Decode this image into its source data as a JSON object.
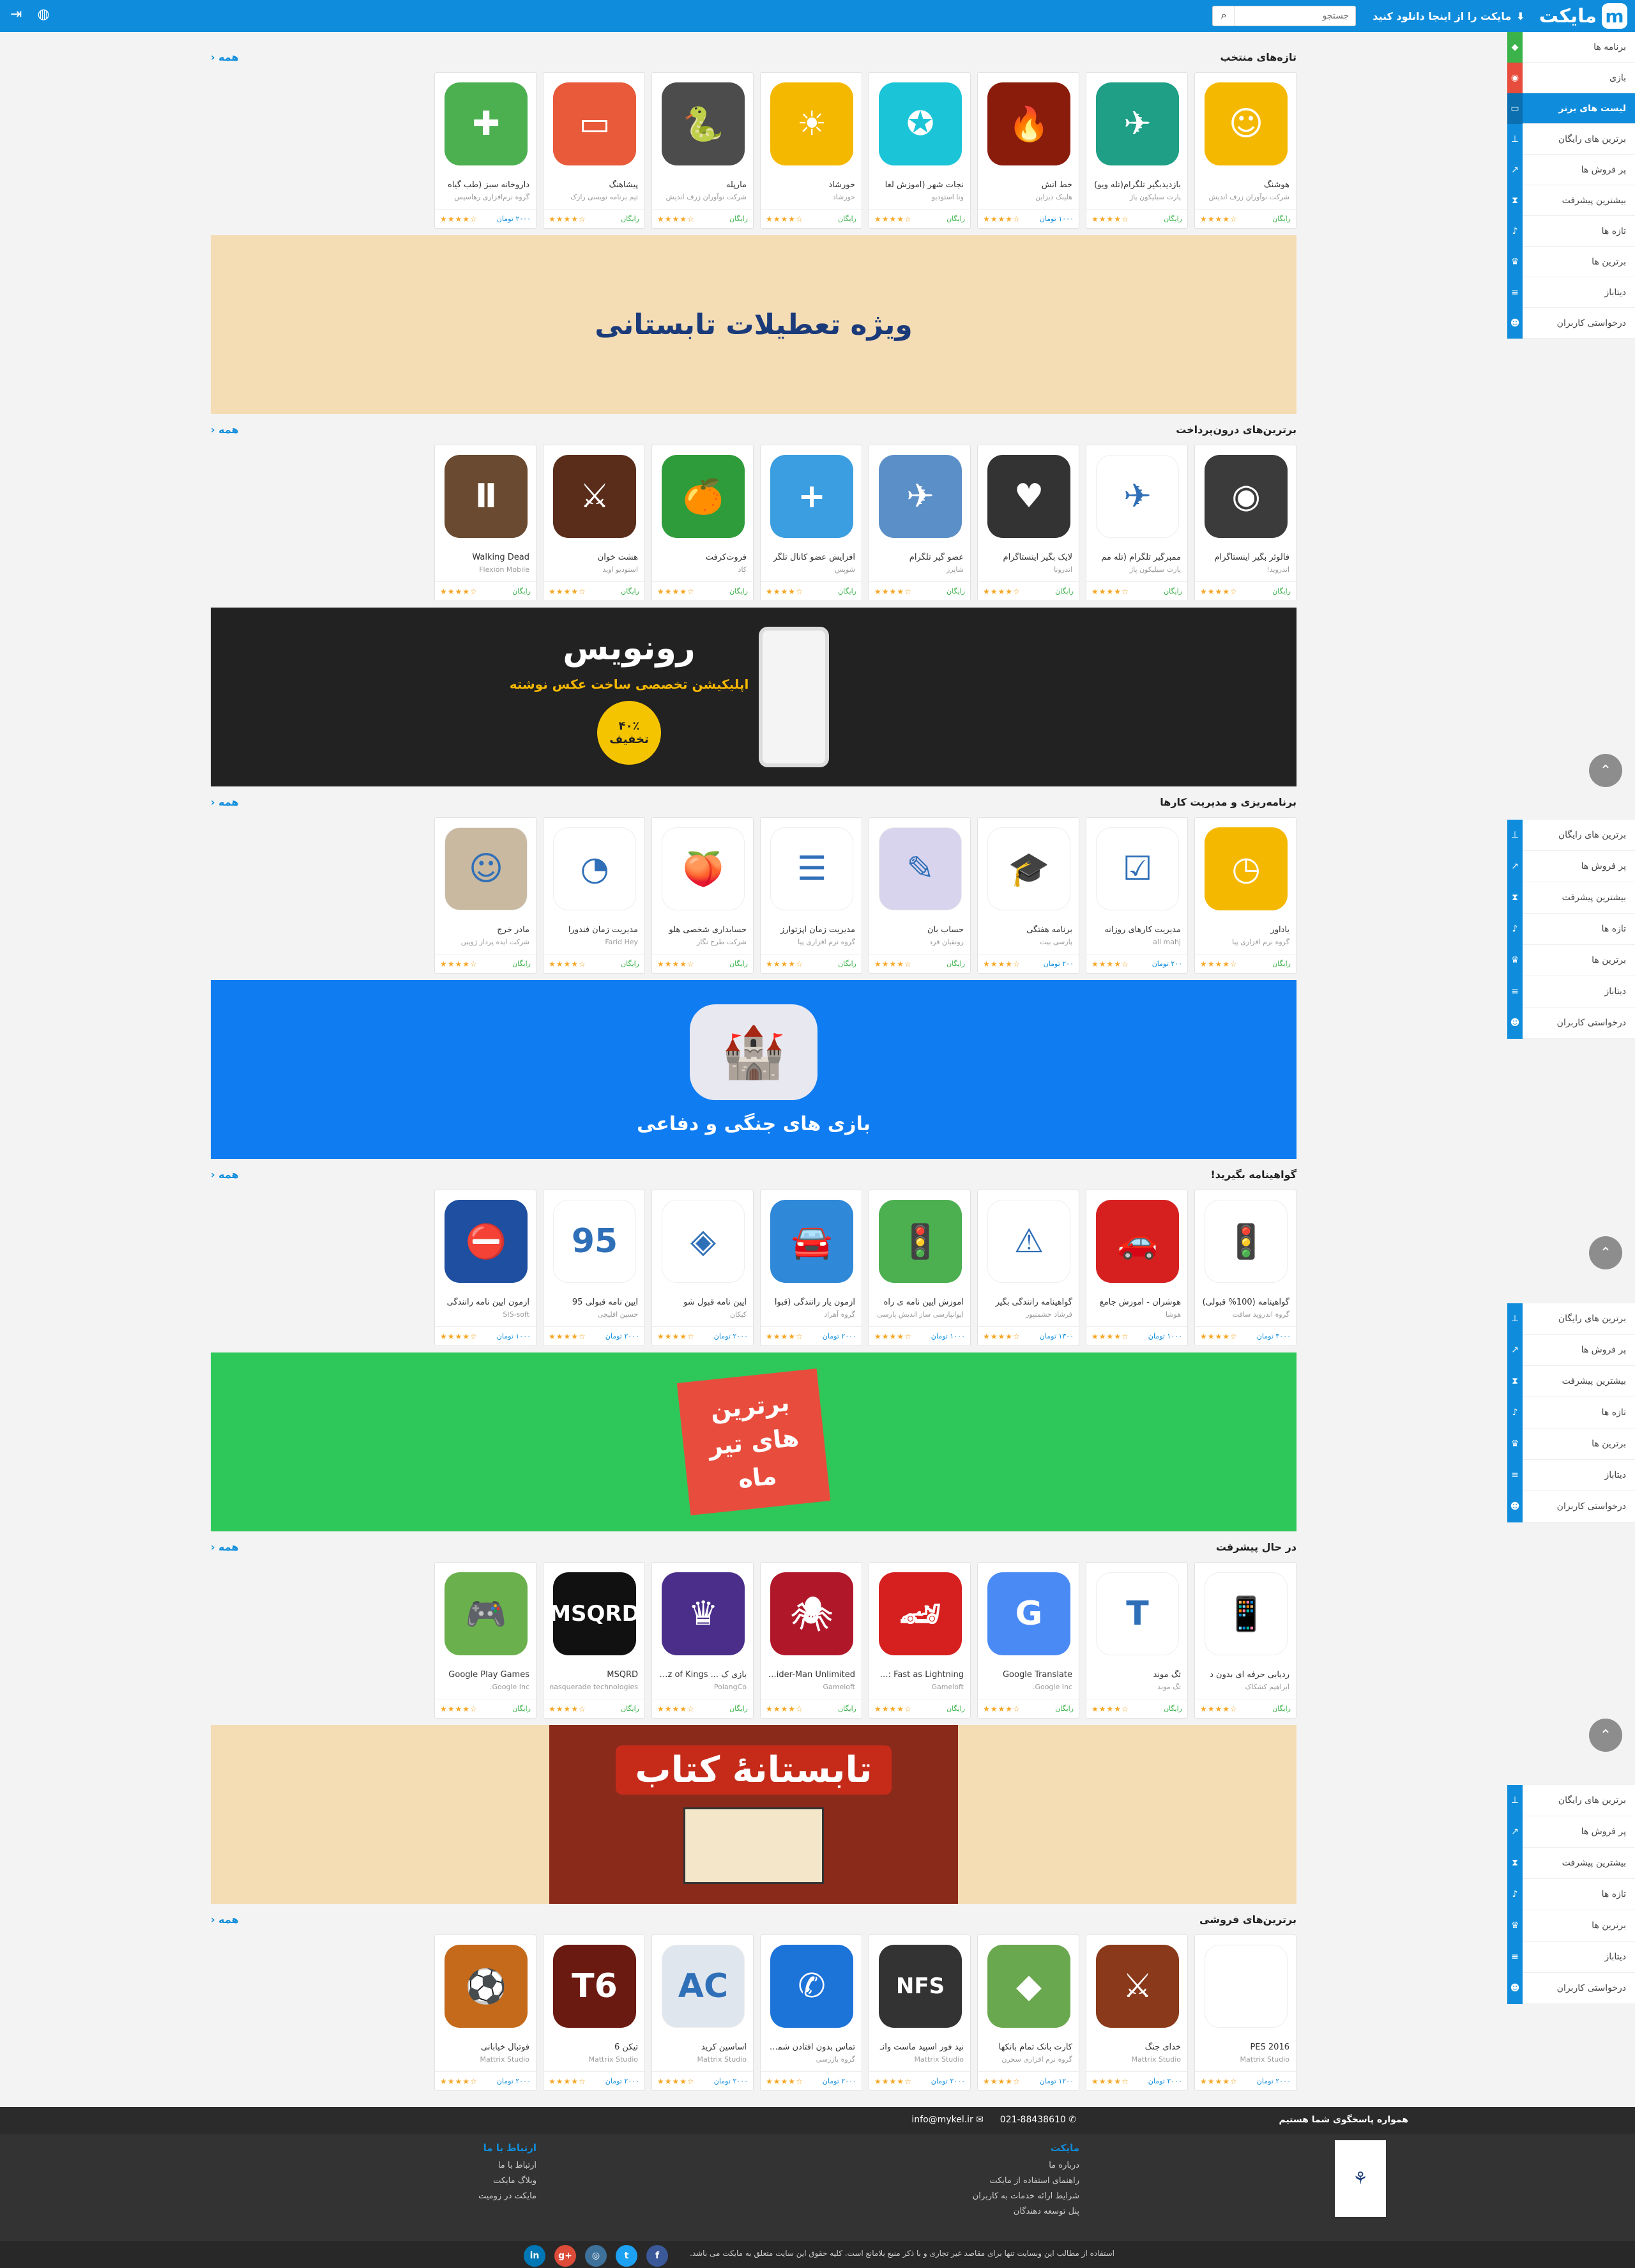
{
  "header": {
    "brand": "مایکت",
    "download_label": "مایکت را از اینجا دانلود کنید",
    "search_placeholder": "جستجو"
  },
  "main_menu": [
    {
      "label": "برنامه ها",
      "icon": "android-icon"
    },
    {
      "label": "بازی",
      "icon": "gamepad-icon"
    },
    {
      "label": "لیست های برتر",
      "icon": "monitor-icon"
    },
    {
      "label": "برترین های رایگان",
      "icon": "pin-icon"
    },
    {
      "label": "پر فروش ها",
      "icon": "chart-icon"
    },
    {
      "label": "بیشترین پیشرفت",
      "icon": "hourglass-icon"
    },
    {
      "label": "تازه ها",
      "icon": "bell-icon"
    },
    {
      "label": "برترین ها",
      "icon": "trophy-icon"
    },
    {
      "label": "دیتاباز",
      "icon": "database-icon"
    },
    {
      "label": "درخواستی کاربران",
      "icon": "users-icon"
    }
  ],
  "submenu": [
    {
      "label": "برترین های رایگان"
    },
    {
      "label": "پر فروش ها"
    },
    {
      "label": "بیشترین پیشرفت"
    },
    {
      "label": "تازه ها"
    },
    {
      "label": "برترین ها"
    },
    {
      "label": "دیتاباز"
    },
    {
      "label": "درخواستی کاربران"
    }
  ],
  "all_label": "همه",
  "sections": [
    {
      "title": "تازه‌های منتخب",
      "apps": [
        {
          "name": "هوشنگ",
          "dev": "شرکت نوآوران زرف اندیش",
          "price": "رایگان",
          "color": "#f5b800",
          "glyph": "☺"
        },
        {
          "name": "بازدیدبگیر تلگرام(تله ویو)",
          "dev": "پارت سیلیکون پاژ",
          "price": "رایگان",
          "color": "#1e9f86",
          "glyph": "✈"
        },
        {
          "name": "خط آتش",
          "dev": "هلیبک دیزاین",
          "price": "۱۰۰۰ تومان",
          "color": "#8a1c0c",
          "glyph": "🔥"
        },
        {
          "name": "نجات شهر (آموزش لغا",
          "dev": "ونا استودیو",
          "price": "رایگان",
          "color": "#1cc4d8",
          "glyph": "✪"
        },
        {
          "name": "خورشاد",
          "dev": "خورشاد",
          "price": "رایگان",
          "color": "#f5b800",
          "glyph": "☀"
        },
        {
          "name": "مارپله",
          "dev": "شرکت نوآوران زرف اندیش",
          "price": "رایگان",
          "color": "#4c4c4c",
          "glyph": "🐍"
        },
        {
          "name": "پیشاهنگ",
          "dev": "تیم برنامه نویسی رازک",
          "price": "رایگان",
          "color": "#e85a3a",
          "glyph": "▭"
        },
        {
          "name": "داروخانه سبز (طب گیاه",
          "dev": "گروه نرم‌افزاری رهاسیس",
          "price": "۲۰۰۰ تومان",
          "color": "#4caf50",
          "glyph": "✚"
        }
      ]
    },
    {
      "title": "برترین‌های درون‌پرداخت",
      "apps": [
        {
          "name": "فالوئر بگیر اینستاگرام",
          "dev": "اندروید!",
          "price": "رایگان",
          "color": "#3b3b3b",
          "glyph": "◉"
        },
        {
          "name": "ممبرگیر تلگرام (تله مم",
          "dev": "پارت سیلیکون پاژ",
          "price": "رایگان",
          "color": "#ffffff",
          "glyph": "✈"
        },
        {
          "name": "لایک بگیر اینستاگرام",
          "dev": "اندرونا",
          "price": "رایگان",
          "color": "#333333",
          "glyph": "♥"
        },
        {
          "name": "عضو گیر تلگرام",
          "dev": "شاپرز",
          "price": "رایگان",
          "color": "#5b8fc7",
          "glyph": "✈"
        },
        {
          "name": "افزایش عضو کانال تلگر",
          "dev": "شوپس",
          "price": "رایگان",
          "color": "#3a9ee0",
          "glyph": "+"
        },
        {
          "name": "فروت‌کرفت",
          "dev": "کاد",
          "price": "رایگان",
          "color": "#2e9c3a",
          "glyph": "🍊"
        },
        {
          "name": "هشت خوان",
          "dev": "استودیو اوید",
          "price": "رایگان",
          "color": "#5a2d1a",
          "glyph": "⚔"
        },
        {
          "name": "Walking Dead",
          "dev": "Flexion Mobile",
          "price": "رایگان",
          "color": "#6a4a30",
          "glyph": "Ⅱ"
        }
      ]
    },
    {
      "title": "برنامه‌ریزی و مدیریت کارها",
      "apps": [
        {
          "name": "یادآور",
          "dev": "گروه نرم افزاری پیا",
          "price": "رایگان",
          "color": "#f5b800",
          "glyph": "◷"
        },
        {
          "name": "مدیریت کارهای روزانه",
          "dev": "ali mahj",
          "price": "۲۰۰ تومان",
          "color": "#ffffff",
          "glyph": "☑"
        },
        {
          "name": "برنامه هفتگی",
          "dev": "پارسی بیت",
          "price": "۲۰۰ تومان",
          "color": "#ffffff",
          "glyph": "🎓"
        },
        {
          "name": "حساب بان",
          "dev": "رونقیان فرد",
          "price": "رایگان",
          "color": "#d8d4ee",
          "glyph": "✎"
        },
        {
          "name": "مدیریت زمان آپزتوارز",
          "dev": "گروه نرم افزاری پیا",
          "price": "رایگان",
          "color": "#ffffff",
          "glyph": "☰"
        },
        {
          "name": "حسابداری شخصی هلو",
          "dev": "شرکت طرح نگار",
          "price": "رایگان",
          "color": "#ffffff",
          "glyph": "🍑"
        },
        {
          "name": "مدیریت زمان فندورا",
          "dev": "Farid Hey",
          "price": "رایگان",
          "color": "#ffffff",
          "glyph": "◔"
        },
        {
          "name": "مادر خرج",
          "dev": "شرکت ایده پرداز ژوپین",
          "price": "رایگان",
          "color": "#c9b9a0",
          "glyph": "☺"
        }
      ]
    },
    {
      "title": "گواهینامه بگیرید!",
      "apps": [
        {
          "name": "گواهینامه (100% قبولی)",
          "dev": "گروه اندروید سافت",
          "price": "۳۰۰۰ تومان",
          "color": "#ffffff",
          "glyph": "🚦"
        },
        {
          "name": "هوشران - آموزش جامع",
          "dev": "هوشا",
          "price": "۱۰۰۰ تومان",
          "color": "#d62020",
          "glyph": "🚗"
        },
        {
          "name": "گواهینامه رانندگی بگیر",
          "dev": "فرشاد حشمتپور",
          "price": "۱۳۰۰ تومان",
          "color": "#ffffff",
          "glyph": "⚠"
        },
        {
          "name": "آموزش آیین نامه ی راه",
          "dev": "ایوانپارسی ساز اندیش پارسی",
          "price": "۱۰۰۰ تومان",
          "color": "#4caf50",
          "glyph": "🚦"
        },
        {
          "name": "آزمون یار رانندگی (قبوا",
          "dev": "گروه آهراد",
          "price": "۲۰۰۰ تومان",
          "color": "#2f88d8",
          "glyph": "🚘"
        },
        {
          "name": "آیین نامه قبول شو",
          "dev": "کیکان",
          "price": "۲۰۰۰ تومان",
          "color": "#ffffff",
          "glyph": "◈"
        },
        {
          "name": "آیین نامه قبولی 95",
          "dev": "حسین افلیچی",
          "price": "۲۰۰۰ تومان",
          "color": "#ffffff",
          "glyph": "95"
        },
        {
          "name": "آزمون آیین نامه رانندگی",
          "dev": "SIS-soft",
          "price": "۱۰۰۰ تومان",
          "color": "#1e4fa0",
          "glyph": "⛔"
        }
      ]
    },
    {
      "title": "در حال پیشرفت",
      "apps": [
        {
          "name": "ردیابی حرفه ای بدون د",
          "dev": "ابراهیم کشکاک",
          "price": "رایگان",
          "color": "#ffffff",
          "glyph": "📱"
        },
        {
          "name": "تگ موند",
          "dev": "تگ موند",
          "price": "رایگان",
          "color": "#ffffff",
          "glyph": "T"
        },
        {
          "name": "Google Translate",
          "dev": "Google Inc.",
          "price": "رایگان",
          "color": "#4a8af4",
          "glyph": "G"
        },
        {
          "name": "Cars: Fast as Lightning",
          "dev": "Gameloft",
          "price": "رایگان",
          "color": "#d62020",
          "glyph": "🏎"
        },
        {
          "name": "Spider-Man Unlimited",
          "dev": "Gameloft",
          "price": "رایگان",
          "color": "#b0182a",
          "glyph": "🕷"
        },
        {
          "name": "بازی ک ... Quiz of Kings",
          "dev": "PolangCo",
          "price": "رایگان",
          "color": "#4a2e8a",
          "glyph": "♛"
        },
        {
          "name": "MSQRD",
          "dev": "masquerade technologies",
          "price": "رایگان",
          "color": "#111111",
          "glyph": "MSQRD"
        },
        {
          "name": "Google Play Games",
          "dev": "Google Inc.",
          "price": "رایگان",
          "color": "#6ab04c",
          "glyph": "🎮"
        }
      ]
    },
    {
      "title": "برترین‌های فروشی",
      "apps": [
        {
          "name": "PES 2016",
          "dev": "Mattrix Studio",
          "price": "۲۰۰۰ تومان",
          "color": "#ffffff",
          "glyph": ""
        },
        {
          "name": "خدای جنگ",
          "dev": "Mattrix Studio",
          "price": "۲۰۰۰ تومان",
          "color": "#8a3a1a",
          "glyph": "⚔"
        },
        {
          "name": "کارت بانک تمام بانکها",
          "dev": "گروه نرم افزاری سحرن",
          "price": "۱۲۰۰ تومان",
          "color": "#6aa84f",
          "glyph": "◆"
        },
        {
          "name": "نید فور اسپید ماست وانـ",
          "dev": "Mattrix Studio",
          "price": "۲۰۰۰ تومان",
          "color": "#333333",
          "glyph": "NFS"
        },
        {
          "name": "تماس بدون افتادن شماره",
          "dev": "گروه بازرسی",
          "price": "۲۰۰۰ تومان",
          "color": "#1c73d8",
          "glyph": "✆"
        },
        {
          "name": "اساسین کرید",
          "dev": "Mattrix Studio",
          "price": "۲۰۰۰ تومان",
          "color": "#dfe6ee",
          "glyph": "AC"
        },
        {
          "name": "تیکن 6",
          "dev": "Mattrix Studio",
          "price": "۲۰۰۰ تومان",
          "color": "#6a1a10",
          "glyph": "T6"
        },
        {
          "name": "فوتبال خیابانی",
          "dev": "Mattrix Studio",
          "price": "۲۰۰۰ تومان",
          "color": "#c46a1a",
          "glyph": "⚽"
        }
      ]
    }
  ],
  "banners": [
    {
      "text": "ویژه تعطیلات تابستانی",
      "bg": "#f4dcb4",
      "fg": "#1a3a7a"
    },
    {
      "text": "رونویس",
      "sub": "اپلیکیشن تخصصی ساخت عکس نوشته",
      "badge": "۴۰٪ تخفیف",
      "bg": "#222222",
      "fg": "#ffffff"
    },
    {
      "text": "بازی های جنگی و دفاعی",
      "bg": "#0f7cf2",
      "fg": "#ffffff"
    },
    {
      "text": "برترین های تیر ماه",
      "bg": "#2ec85a",
      "fg": "#ffffff"
    },
    {
      "text": "تابستانهٔ کتاب",
      "bg": "#f4dcb4",
      "fg": "#ffffff"
    }
  ],
  "footer": {
    "tagline": "همواره پاسخگوی شما هستیم",
    "phone": "021-88438610",
    "email": "info@mykel.ir",
    "col1_title": "مایکت",
    "col1_links": [
      "درباره ما",
      "راهنمای استفاده از مایکت",
      "شرایط ارائه خدمات به کاربران",
      "پنل توسعه دهندگان"
    ],
    "col2_title": "ارتباط با ما",
    "col2_links": [
      "ارتباط با ما",
      "وبلاگ مایکت",
      "مایکت در زومیت"
    ],
    "copyright": "استفاده از مطالب این وبسایت تنها برای مقاصد غیر تجاری و با ذکر منبع بلامانع است. کلیه حقوق این سایت متعلق به مایکت می باشد.",
    "social": [
      {
        "label": "f",
        "color": "#3b5998"
      },
      {
        "label": "t",
        "color": "#1da1f2"
      },
      {
        "label": "◎",
        "color": "#3f729b"
      },
      {
        "label": "g+",
        "color": "#dd4b39"
      },
      {
        "label": "in",
        "color": "#0077b5"
      }
    ]
  }
}
